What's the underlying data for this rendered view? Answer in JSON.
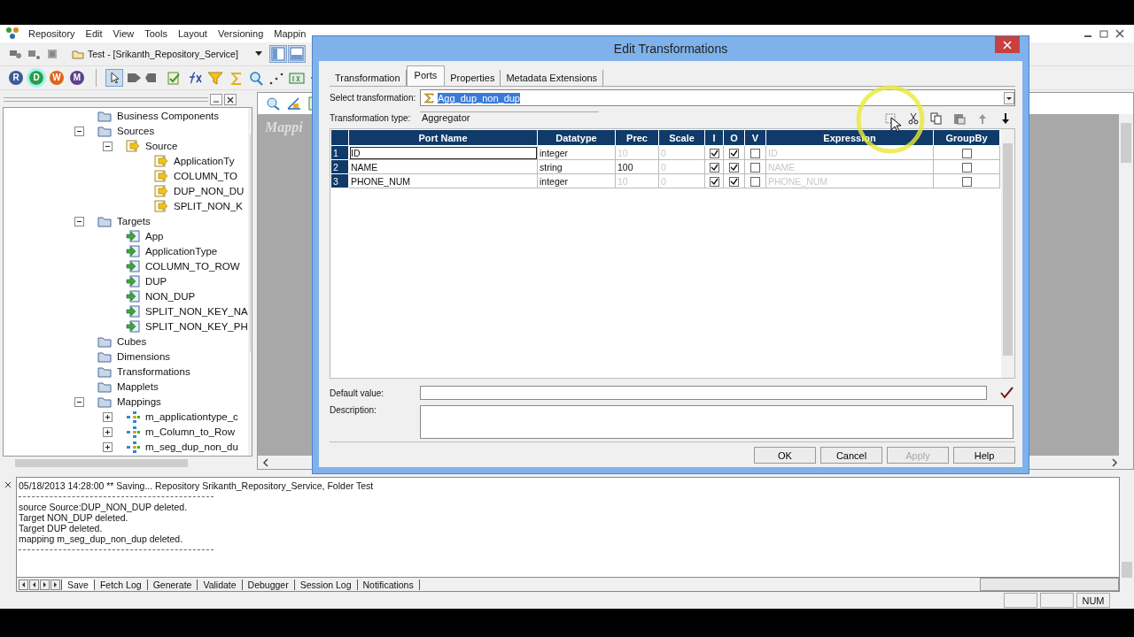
{
  "menu": [
    "Repository",
    "Edit",
    "View",
    "Tools",
    "Layout",
    "Versioning",
    "Mappin"
  ],
  "folder_selector": {
    "value": "Test - [Srikanth_Repository_Service]"
  },
  "tool_buttons": [
    {
      "label": "R",
      "selected": false,
      "color": "#3d5a99"
    },
    {
      "label": "D",
      "selected": true,
      "color": "#2f9a4c"
    },
    {
      "label": "W",
      "selected": false,
      "color": "#e0641c"
    },
    {
      "label": "M",
      "selected": false,
      "color": "#5b3f8c"
    }
  ],
  "navigator": {
    "tree": [
      {
        "label": "Business Components",
        "kind": "folder"
      },
      {
        "label": "Sources",
        "kind": "folder",
        "expanded": true,
        "children": [
          {
            "label": "Source",
            "kind": "source",
            "expanded": true,
            "children": [
              {
                "label": "ApplicationTy",
                "kind": "source"
              },
              {
                "label": "COLUMN_TO",
                "kind": "source"
              },
              {
                "label": "DUP_NON_DU",
                "kind": "source"
              },
              {
                "label": "SPLIT_NON_K",
                "kind": "source"
              }
            ]
          }
        ]
      },
      {
        "label": "Targets",
        "kind": "folder",
        "expanded": true,
        "children": [
          {
            "label": "App",
            "kind": "target"
          },
          {
            "label": "ApplicationType",
            "kind": "target"
          },
          {
            "label": "COLUMN_TO_ROW",
            "kind": "target"
          },
          {
            "label": "DUP",
            "kind": "target"
          },
          {
            "label": "NON_DUP",
            "kind": "target"
          },
          {
            "label": "SPLIT_NON_KEY_NA",
            "kind": "target"
          },
          {
            "label": "SPLIT_NON_KEY_PH",
            "kind": "target"
          }
        ]
      },
      {
        "label": "Cubes",
        "kind": "folder"
      },
      {
        "label": "Dimensions",
        "kind": "folder"
      },
      {
        "label": "Transformations",
        "kind": "folder"
      },
      {
        "label": "Mapplets",
        "kind": "folder"
      },
      {
        "label": "Mappings",
        "kind": "folder",
        "expanded": true,
        "children": [
          {
            "label": "m_applicationtype_c",
            "kind": "mapping",
            "expanded": false
          },
          {
            "label": "m_Column_to_Row",
            "kind": "mapping",
            "expanded": false
          },
          {
            "label": "m_seg_dup_non_du",
            "kind": "mapping",
            "expanded": false
          }
        ]
      }
    ]
  },
  "workspace": {
    "title": "Mappi"
  },
  "dialog": {
    "title": "Edit Transformations",
    "tabs": [
      {
        "label": "Transformation",
        "selected": false
      },
      {
        "label": "Ports",
        "selected": true
      },
      {
        "label": "Properties",
        "selected": false
      },
      {
        "label": "Metadata Extensions",
        "selected": false
      }
    ],
    "select_transformation": {
      "label": "Select transformation:",
      "value": "Agg_dup_non_dup",
      "text_selected": true
    },
    "transformation_type": {
      "label": "Transformation type:",
      "value": "Aggregator"
    },
    "ports": {
      "columns": [
        "Port Name",
        "Datatype",
        "Prec",
        "Scale",
        "I",
        "O",
        "V",
        "Expression",
        "GroupBy"
      ],
      "rows": [
        {
          "number": "1",
          "port_name": "ID",
          "datatype": "integer",
          "prec": "10",
          "prec_disabled": true,
          "scale": "0",
          "input": true,
          "output": true,
          "variable": false,
          "expression": "ID",
          "group_by": false,
          "selected": true
        },
        {
          "number": "2",
          "port_name": "NAME",
          "datatype": "string",
          "prec": "100",
          "prec_disabled": false,
          "scale": "0",
          "input": true,
          "output": true,
          "variable": false,
          "expression": "NAME",
          "group_by": false,
          "selected": false
        },
        {
          "number": "3",
          "port_name": "PHONE_NUM",
          "datatype": "integer",
          "prec": "10",
          "prec_disabled": true,
          "scale": "0",
          "input": true,
          "output": true,
          "variable": false,
          "expression": "PHONE_NUM",
          "group_by": false,
          "selected": false
        }
      ]
    },
    "default_value": {
      "label": "Default value:"
    },
    "description": {
      "label": "Description:"
    },
    "buttons": [
      {
        "label": "OK",
        "disabled": false
      },
      {
        "label": "Cancel",
        "disabled": false
      },
      {
        "label": "Apply",
        "disabled": true
      },
      {
        "label": "Help",
        "disabled": false
      }
    ]
  },
  "output": {
    "header": "05/18/2013 14:28:00 ** Saving... Repository Srikanth_Repository_Service, Folder Test",
    "lines": [
      "source Source:DUP_NON_DUP deleted.",
      "Target NON_DUP deleted.",
      "Target DUP deleted.",
      "mapping  m_seg_dup_non_dup deleted."
    ],
    "tabs": [
      {
        "label": "Save",
        "selected": true
      },
      {
        "label": "Fetch Log",
        "selected": false
      },
      {
        "label": "Generate",
        "selected": false
      },
      {
        "label": "Validate",
        "selected": false
      },
      {
        "label": "Debugger",
        "selected": false
      },
      {
        "label": "Session Log",
        "selected": false
      },
      {
        "label": "Notifications",
        "selected": false
      }
    ]
  },
  "status_bar": {
    "num": "NUM"
  }
}
